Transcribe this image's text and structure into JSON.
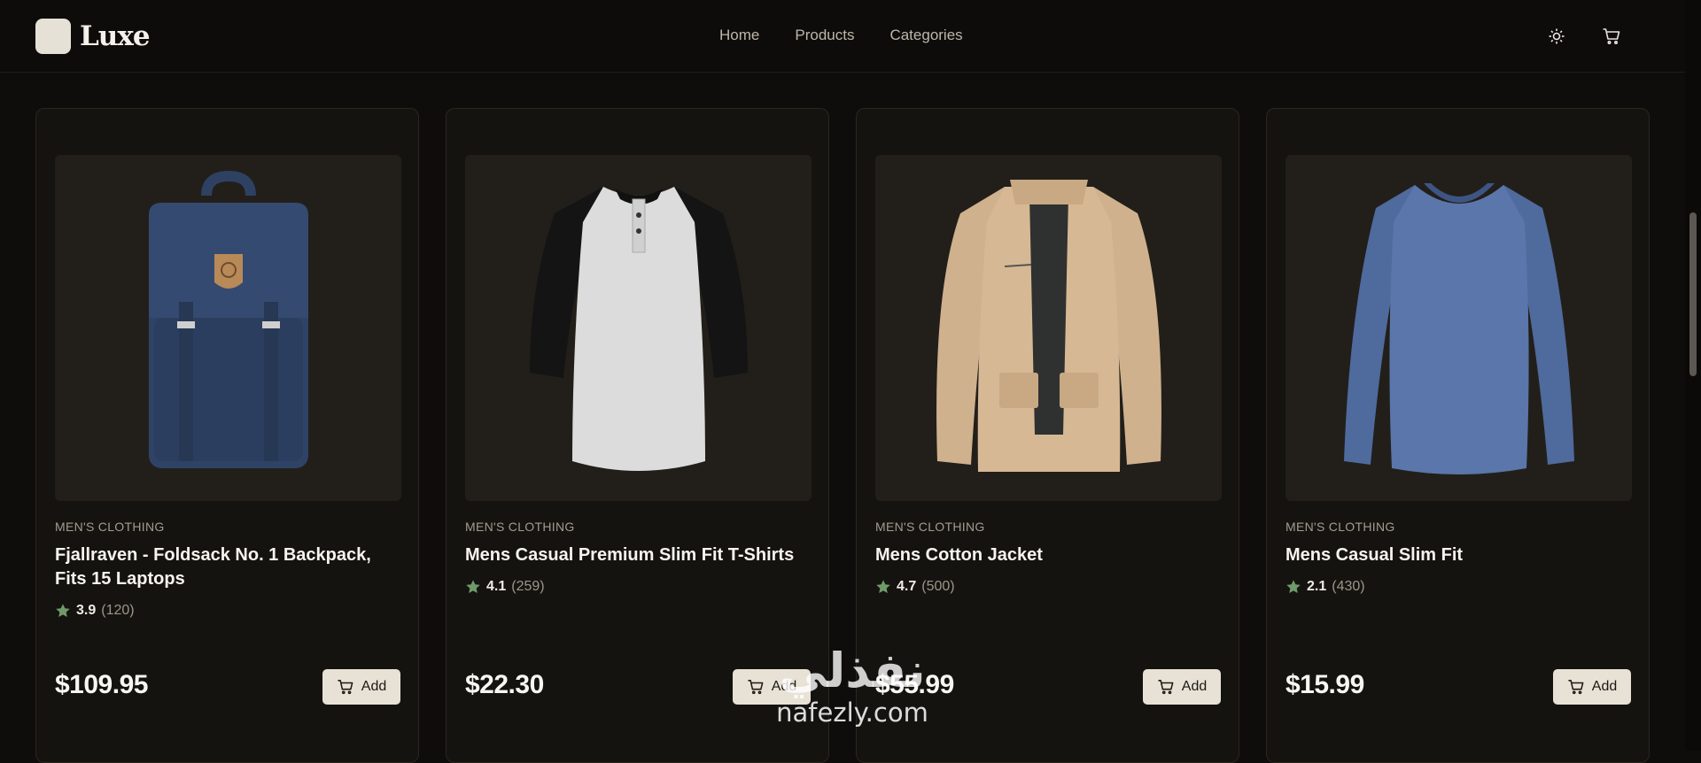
{
  "header": {
    "brand": "Luxe",
    "nav": [
      "Home",
      "Products",
      "Categories"
    ],
    "theme_icon": "sun-icon",
    "cart_icon": "cart-icon"
  },
  "products": [
    {
      "category": "MEN'S CLOTHING",
      "title": "Fjallraven - Foldsack No. 1 Backpack, Fits 15 Laptops",
      "rating": "3.9",
      "count": "(120)",
      "price": "$109.95",
      "add_label": "Add",
      "image_icon": "backpack-image"
    },
    {
      "category": "MEN'S CLOTHING",
      "title": "Mens Casual Premium Slim Fit T-Shirts",
      "rating": "4.1",
      "count": "(259)",
      "price": "$22.30",
      "add_label": "Add",
      "image_icon": "raglan-tshirt-image"
    },
    {
      "category": "MEN'S CLOTHING",
      "title": "Mens Cotton Jacket",
      "rating": "4.7",
      "count": "(500)",
      "price": "$55.99",
      "add_label": "Add",
      "image_icon": "cotton-jacket-image"
    },
    {
      "category": "MEN'S CLOTHING",
      "title": "Mens Casual Slim Fit",
      "rating": "2.1",
      "count": "(430)",
      "price": "$15.99",
      "add_label": "Add",
      "image_icon": "longsleeve-shirt-image"
    }
  ],
  "watermark": {
    "arabic": "نفذلي",
    "latin": "nafezly.com"
  },
  "colors": {
    "star": "#6f9a6a",
    "button_bg": "#e8e2d6",
    "card_bg": "#15130f"
  }
}
